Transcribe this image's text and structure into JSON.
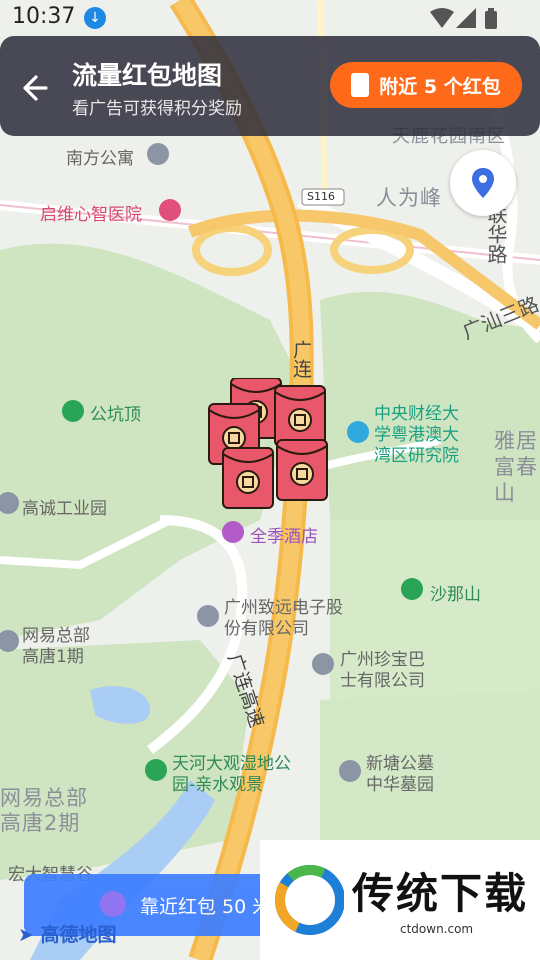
{
  "status_bar": {
    "time": "10:37"
  },
  "header": {
    "back_label": "返回",
    "title": "流量红包地图",
    "subtitle": "看广告可获得积分奖励",
    "nearby_button": "附近 5 个红包"
  },
  "map": {
    "labels": {
      "nanfang_apartment": "南方公寓",
      "qiwei_hospital": "启维心智医院",
      "renweifeng": "人为峰",
      "tianlu_south": "天鹿花园南区",
      "tianlu_top": "天鹿花园",
      "guangshan_road": "广汕三路",
      "lianhua_road": "联华路",
      "s116": "S116",
      "gongkengding": "公坑顶",
      "central_finance": "中央财经大学粤港澳大湾区研究院",
      "yaju": "雅居",
      "fuchun": "富春山",
      "gaocheng_industrial": "高诚工业园",
      "quanji_hotel": "全季酒店",
      "shanashan": "沙那山",
      "zhiyuan": "广州致远电子股份有限公司",
      "netease_1": "网易总部高唐1期",
      "zhenbao": "广州珍宝巴士有限公司",
      "tianhe_wetland": "天河大观湿地公园-亲水观景",
      "xintang_cemetery": "新塘公墓中华墓园",
      "netease_2": "网易总部高唐2期",
      "hongda": "宏大智慧谷",
      "guanglian_1": "广连",
      "guanglian_2": "广连高速",
      "guanglian_top": "广连高速"
    }
  },
  "red_packets": {
    "count": 5
  },
  "bottom": {
    "distance_text": "靠近红包 50 米",
    "amap_logo": "高德地图"
  },
  "watermark": {
    "title": "传统下载",
    "url": "ctdown.com"
  },
  "colors": {
    "accent": "#ff6a1a",
    "header_bg": "#2d2d3c",
    "map_green": "#cfe5c1",
    "highway": "#f6b94c"
  }
}
